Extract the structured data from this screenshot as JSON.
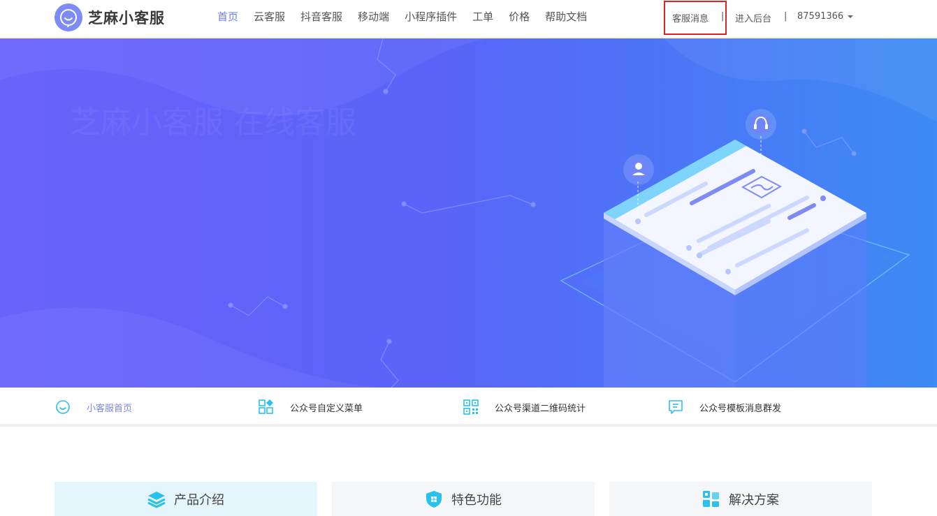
{
  "header": {
    "brand": "芝麻小客服",
    "nav": [
      {
        "label": "首页",
        "active": true
      },
      {
        "label": "云客服",
        "active": false
      },
      {
        "label": "抖音客服",
        "active": false
      },
      {
        "label": "移动端",
        "active": false
      },
      {
        "label": "小程序插件",
        "active": false
      },
      {
        "label": "工单",
        "active": false
      },
      {
        "label": "价格",
        "active": false
      },
      {
        "label": "帮助文档",
        "active": false
      }
    ],
    "kf_message": "客服消息",
    "separator": "|",
    "admin_link": "进入后台",
    "account_id": "87591366"
  },
  "subnav": [
    {
      "label": "小客服首页",
      "icon": "smile-icon",
      "active": true
    },
    {
      "label": "公众号自定义菜单",
      "icon": "grid-menu-icon",
      "active": false
    },
    {
      "label": "公众号渠道二维码统计",
      "icon": "qrcode-icon",
      "active": false
    },
    {
      "label": "公众号模板消息群发",
      "icon": "message-icon",
      "active": false
    }
  ],
  "tabs": [
    {
      "label": "产品介绍",
      "icon": "layers-icon",
      "active": true
    },
    {
      "label": "特色功能",
      "icon": "shield-icon",
      "active": false
    },
    {
      "label": "解决方案",
      "icon": "blocks-icon",
      "active": false
    }
  ],
  "colors": {
    "accent": "#6a7df0",
    "highlight_box": "#d9252a",
    "hero_start": "#6b62fb",
    "hero_end": "#3d8bf4",
    "icon_cyan": "#29c2ec"
  }
}
